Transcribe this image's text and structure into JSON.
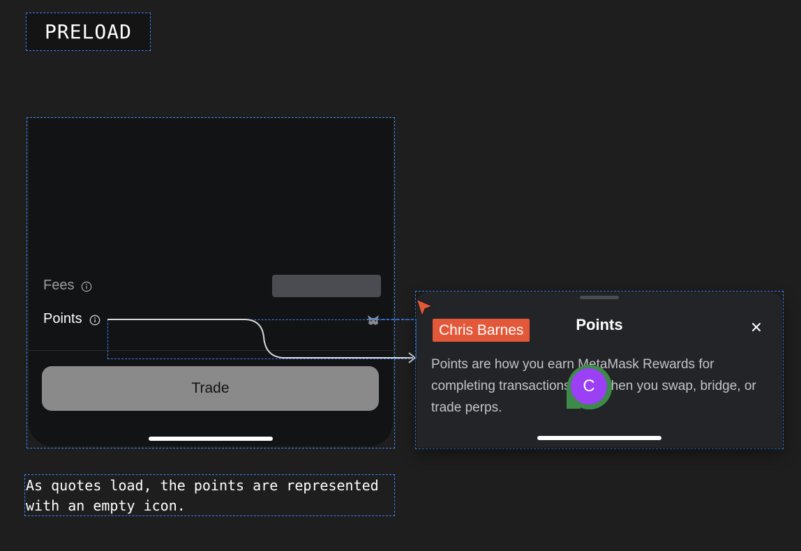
{
  "section_label": "PRELOAD",
  "quote": {
    "fees_label": "Fees",
    "points_label": "Points",
    "trade_button": "Trade"
  },
  "sheet": {
    "title": "Points",
    "body": "Points are how you earn MetaMask Rewards for completing transactions, like when you swap, bridge, or trade perps."
  },
  "collaborator": {
    "name": "Chris Barnes",
    "avatar_initial": "C",
    "name_color": "#e4583a",
    "avatar_color": "#9b40f5"
  },
  "note": "As quotes load, the points are represented with an empty icon.",
  "colors": {
    "background": "#1e1e1e",
    "annotation_outline": "#3b82f6",
    "phone_background": "#121314",
    "sheet_background": "#222427",
    "skeleton": "#4a4c52",
    "trade_button_disabled": "#8a8a8a"
  },
  "icons": {
    "info": "info-icon",
    "points_placeholder": "metamask-fox-icon",
    "close": "close-icon",
    "cursor": "cursor-arrow-icon"
  }
}
